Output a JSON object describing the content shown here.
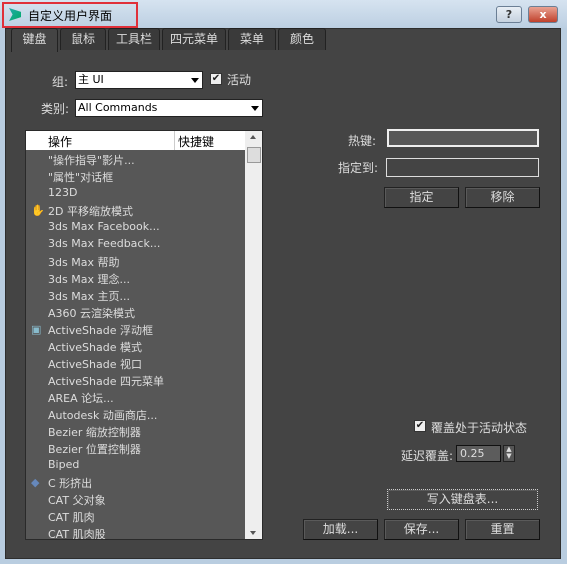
{
  "window": {
    "title": "自定义用户界面",
    "help_label": "?",
    "close_label": "x"
  },
  "tabs": [
    {
      "label": "键盘",
      "active": true
    },
    {
      "label": "鼠标"
    },
    {
      "label": "工具栏"
    },
    {
      "label": "四元菜单"
    },
    {
      "label": "菜单"
    },
    {
      "label": "颜色"
    }
  ],
  "group": {
    "label": "组:",
    "value": "主 UI",
    "active_label": "活动",
    "active_checked": true
  },
  "category": {
    "label": "类别:",
    "value": "All Commands"
  },
  "list": {
    "col_action": "操作",
    "col_shortcut": "快捷键",
    "items": [
      {
        "text": "\"操作指导\"影片..."
      },
      {
        "text": "\"属性\"对话框"
      },
      {
        "text": "123D"
      },
      {
        "text": "2D 平移缩放模式",
        "icon": "hand-icon"
      },
      {
        "text": "3ds Max Facebook..."
      },
      {
        "text": "3ds Max Feedback..."
      },
      {
        "text": "3ds Max 帮助"
      },
      {
        "text": "3ds Max 理念..."
      },
      {
        "text": "3ds Max 主页..."
      },
      {
        "text": "A360 云渲染模式"
      },
      {
        "text": "ActiveShade 浮动框",
        "icon": "activeshade-icon"
      },
      {
        "text": "ActiveShade 模式"
      },
      {
        "text": "ActiveShade 视口"
      },
      {
        "text": "ActiveShade 四元菜单"
      },
      {
        "text": "AREA 论坛..."
      },
      {
        "text": "Autodesk 动画商店..."
      },
      {
        "text": "Bezier 缩放控制器"
      },
      {
        "text": "Bezier 位置控制器"
      },
      {
        "text": "Biped"
      },
      {
        "text": "C 形挤出",
        "icon": "extrude-icon"
      },
      {
        "text": "CAT 父对象"
      },
      {
        "text": "CAT 肌肉"
      },
      {
        "text": "CAT 肌肉股"
      }
    ]
  },
  "hotkey": {
    "label": "热键:",
    "value": ""
  },
  "assigned_to": {
    "label": "指定到:",
    "value": ""
  },
  "buttons": {
    "assign": "指定",
    "remove": "移除",
    "write": "写入键盘表...",
    "load": "加载...",
    "save": "保存...",
    "reset": "重置"
  },
  "override": {
    "label": "覆盖处于活动状态",
    "checked": true,
    "delay_label": "延迟覆盖:",
    "delay_value": "0.25"
  },
  "colors": {
    "panel": "#444444",
    "list": "#575757",
    "highlight": "#e0303a"
  }
}
